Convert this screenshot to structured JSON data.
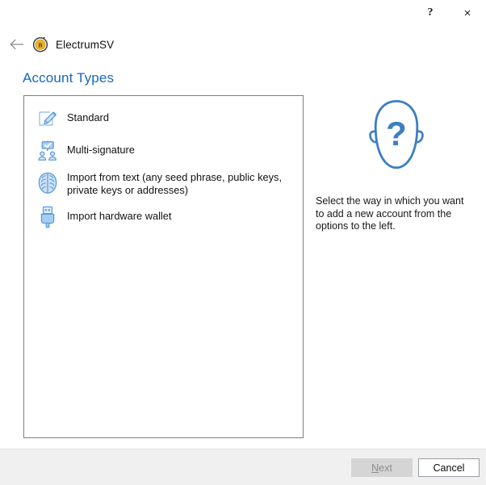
{
  "window": {
    "brand_title": "ElectrumSV",
    "brand_icon": "electrumsv-coin-icon",
    "back_icon": "back-arrow-icon",
    "help_label": "?",
    "help_icon": "help-icon",
    "close_label": "×",
    "close_icon": "close-icon"
  },
  "page": {
    "title": "Account Types",
    "title_color": "#1668c1"
  },
  "account_types": [
    {
      "label": "Standard",
      "icon": "pencil-edit-icon",
      "multiline": false
    },
    {
      "label": "Multi-signature",
      "icon": "multi-signature-people-icon",
      "multiline": false
    },
    {
      "label": "Import from text (any seed phrase, public keys, private keys or addresses)",
      "icon": "brain-icon",
      "multiline": true
    },
    {
      "label": "Import hardware wallet",
      "icon": "usb-hardware-wallet-icon",
      "multiline": false
    }
  ],
  "info_pane": {
    "icon": "head-question-mark-icon",
    "text": "Select the way in which you want to add a new account from the options to the left.",
    "icon_color": "#3b7fc4"
  },
  "footer": {
    "next_label": "Next",
    "next_mnemonic": "N",
    "next_rest": "ext",
    "next_enabled": false,
    "cancel_label": "Cancel",
    "cancel_enabled": true
  },
  "colors": {
    "accent_blue": "#1668c1",
    "icon_blue": "#6aa3dd",
    "icon_blue_dark": "#3b7fc4",
    "panel_border": "#7a7e83",
    "footer_bg": "#f0f0f0",
    "brand_gold": "#f0b429"
  }
}
